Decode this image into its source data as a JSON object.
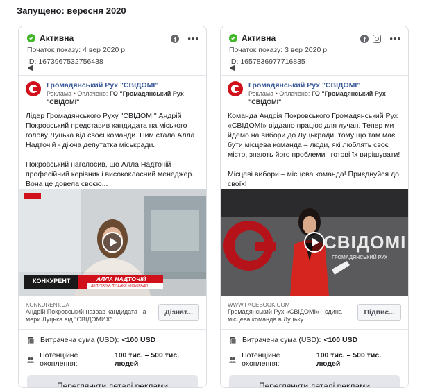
{
  "section_title": "Запущено: вересня 2020",
  "ads": [
    {
      "status": "Активна",
      "start_label": "Початок показу: 4 вер 2020 р.",
      "id_label": "ID: 1673967532756438",
      "platforms": [
        "facebook-icon"
      ],
      "page_name": "Громадянський Рух \"СВІДОМІ\"",
      "sponsor_prefix": "Реклама • Оплачено:",
      "sponsor_name": "ГО \"Громадянський Рух \"СВІДОМІ\"",
      "body": "Лідер Громадянського Руху \"СВІДОМІ\" Андрій Покровський представив кандидата на міського голову Луцька від своєї команди. Ним стала Алла Надточій - діюча депутатка міськради.\n\nПокровський наголосив, що Алла Надточій – професійний керівник і висококласний менеджер. Вона це довела своєю...",
      "media_caption": "АЛЛА НАДТОЧІЙ",
      "media_subcaption": "ДЕПУТАТКА ЛУЦЬКОЇ МІСЬКРАДИ",
      "media_brand": "КОНКУРЕНТ",
      "domain": "KONKURENT.UA",
      "link_title": "Андрій Покровський назвав кандидата на мери Луцька від \"СВІДОМИХ\"",
      "cta": "Дізнат...",
      "spend_label": "Витрачена сума (USD):",
      "spend_value": "<100 USD",
      "reach_label": "Потенційне охоплення:",
      "reach_value": "100 тис. – 500 тис. людей",
      "details_button": "Переглянути деталі реклами"
    },
    {
      "status": "Активна",
      "start_label": "Початок показу: 3 вер 2020 р.",
      "id_label": "ID: 1657836977716835",
      "platforms": [
        "facebook-icon",
        "instagram-icon"
      ],
      "page_name": "Громадянський Рух \"СВІДОМІ\"",
      "sponsor_prefix": "Реклама • Оплачено:",
      "sponsor_name": "ГО \"Громадянський Рух \"СВІДОМІ\"",
      "body": "Команда Андрія Покровського Громадянський Рух «СВІДОМІ» віддано працює для лучан. Тепер ми йдемо на вибори до Луцькради, тому що там має бути місцева команда – люди, які люблять своє місто, знають його проблеми і готові їх вирішувати!\n\nМісцеві вибори – місцева команда! Приєднуйся до своїх!",
      "media_caption": "СВІДОМІ",
      "media_subcaption": "ГРОМАДЯНСЬКИЙ РУХ",
      "domain": "WWW.FACEBOOK.COM",
      "link_title": "Громадянський Рух «СВІДОМІ» - єдина місцева команда в Луцьку",
      "cta": "Підпис...",
      "spend_label": "Витрачена сума (USD):",
      "spend_value": "<100 USD",
      "reach_label": "Потенційне охоплення:",
      "reach_value": "100 тис. – 500 тис. людей",
      "details_button": "Переглянути деталі реклами"
    }
  ],
  "colors": {
    "active": "#42b72a",
    "page_link": "#385898",
    "brand_red": "#d0111b"
  }
}
